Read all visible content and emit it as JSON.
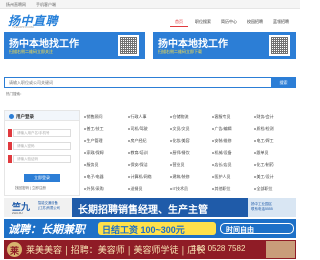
{
  "topbar": {
    "left": "扬州直聘网",
    "right": "手机客户端"
  },
  "header": {
    "logo": "扬中直聘",
    "logo_sub": "YZZHIPIN.COM",
    "nav": [
      "首页",
      "职位搜索",
      "简历中心",
      "校园招聘",
      "蓝领招聘"
    ]
  },
  "banners": [
    {
      "title": "扬中本地找工作",
      "subtitle": "扫描右侧二维码立即关注"
    },
    {
      "title": "扬中本地找工作",
      "subtitle": "扫描右侧二维码立即下载"
    }
  ],
  "search": {
    "placeholder": "请输入职位或公司关键词",
    "button": "搜索"
  },
  "hot": "热门搜索：",
  "login": {
    "title": "用户登录",
    "username_placeholder": "请输入用户名/手机号",
    "password_placeholder": "请输入密码",
    "code_placeholder": "请输入验证码",
    "button": "立即登录",
    "links": "找回密码  |  立即注册"
  },
  "categories": [
    [
      "销售顾问",
      "行政人事",
      "仓储物流",
      "客服专员",
      "财务/会计"
    ],
    [
      "普工/技工",
      "司机/驾驶",
      "文员/文员",
      "广告/编辑",
      "质检/检测"
    ],
    [
      "生产管理",
      "房产经纪",
      "化妆/美容",
      "安装/维修",
      "电工/焊工"
    ],
    [
      "家政/保姆",
      "教育/培训",
      "厨师/餐饮",
      "机械/设备",
      "跟单员"
    ],
    [
      "服务员",
      "保安/保洁",
      "营业员",
      "店长/店员",
      "化工/制药"
    ],
    [
      "电子/电器",
      "计算机/网络",
      "建筑/装修",
      "医护人员",
      "美工/设计"
    ],
    [
      "外贸/采购",
      "送餐员",
      "IT技术员",
      "其他职位",
      "全部职位"
    ]
  ],
  "ads": {
    "ad1_brand": "竺九",
    "ad1_brand_sub": "ZHUJIU",
    "ad1_brand_desc": "智能交通设备\n(江苏)有限公司",
    "ad1_main": "长期招聘销售经理、生产主管",
    "ad1_right": "扬中工业园区\n联系电话5555",
    "ad2_left": "诚聘：长期兼职",
    "ad2_middle": "日结工资 100~300元",
    "ad2_right": "时间自由",
    "ad3_badge": "莱",
    "ad3_text": "莱美美容 | 招聘：美容师 | 美容师学徒 | 店长",
    "ad3_phone": "183 0528 7582"
  },
  "colors": {
    "primary": "#2c7ed6",
    "accent": "#e03a3e",
    "banner_highlight": "#fde046"
  }
}
